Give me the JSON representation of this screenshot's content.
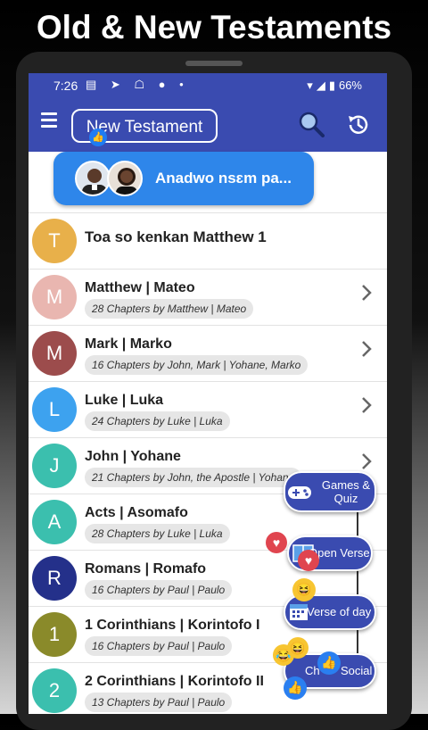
{
  "banner": {
    "title": "Old & New Testaments"
  },
  "statusbar": {
    "time": "7:26",
    "icons_left": "▤ ➤ ☖ ● •",
    "wifi": "▾",
    "signal": "◢",
    "battery": "▮",
    "battery_pct": "66%"
  },
  "appbar": {
    "testament": "New Testament"
  },
  "promo": {
    "label": "Anadwo nsɛm pa..."
  },
  "list": [
    {
      "letter": "T",
      "title": "Toa so kenkan Matthew 1",
      "color": "#e8b04a"
    },
    {
      "letter": "M",
      "title": "Matthew | Mateo",
      "sub": "28 Chapters by Matthew | Mateo",
      "color": "#e9b6b0"
    },
    {
      "letter": "M",
      "title": "Mark | Marko",
      "sub": "16 Chapters by John, Mark | Yohane, Marko",
      "color": "#9c4c4c"
    },
    {
      "letter": "L",
      "title": "Luke | Luka",
      "sub": "24 Chapters by Luke | Luka",
      "color": "#3da2ef"
    },
    {
      "letter": "J",
      "title": "John | Yohane",
      "sub": "21 Chapters by John, the Apostle | Yohane",
      "color": "#3bbfae"
    },
    {
      "letter": "A",
      "title": "Acts | Asomafo",
      "sub": "28 Chapters by Luke | Luka",
      "color": "#3bbfae"
    },
    {
      "letter": "R",
      "title": "Romans | Romafo",
      "sub": "16 Chapters by Paul | Paulo",
      "color": "#24308a"
    },
    {
      "letter": "1",
      "title": "1 Corinthians | Korintofo I",
      "sub": "16 Chapters by Paul | Paulo",
      "color": "#8a8a2a"
    },
    {
      "letter": "2",
      "title": "2 Corinthians | Korintofo II",
      "sub": "13 Chapters by Paul | Paulo",
      "color": "#3bbfae"
    }
  ],
  "fabs": {
    "games": "Games & Quiz",
    "open_verse": "Open Verse",
    "verse_of_day": "Verse of day",
    "social": "Social",
    "social_prefix": "Ch"
  },
  "colors": {
    "primary": "#3a4bb0",
    "promo": "#2e86ea"
  }
}
